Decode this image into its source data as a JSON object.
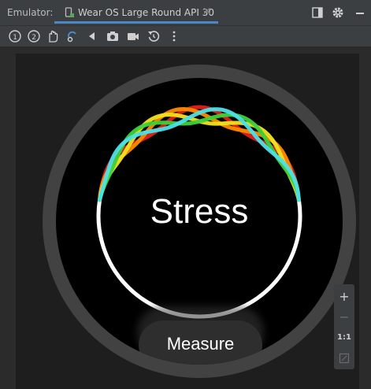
{
  "window": {
    "title_label": "Emulator:",
    "tab": {
      "label": "Wear OS Large Round API 30",
      "close_glyph": "✕"
    }
  },
  "toolbar": {
    "icons": [
      "power-icon",
      "volume-icon",
      "touch-gesture-icon",
      "rotate-icon",
      "back-icon",
      "camera-icon",
      "video-icon",
      "reset-icon",
      "more-icon"
    ]
  },
  "watch": {
    "title": "Stress",
    "button_label": "Measure",
    "ring_colors": [
      "#e0201b",
      "#ff8a00",
      "#f2e21d",
      "#3dd13a",
      "#4ee0e8",
      "#ffffff"
    ]
  },
  "zoom": {
    "zoom_in": "+",
    "zoom_out": "−",
    "actual_size": "1:1"
  },
  "colors": {
    "accent": "#4a88c7",
    "background": "#3c3f41"
  }
}
